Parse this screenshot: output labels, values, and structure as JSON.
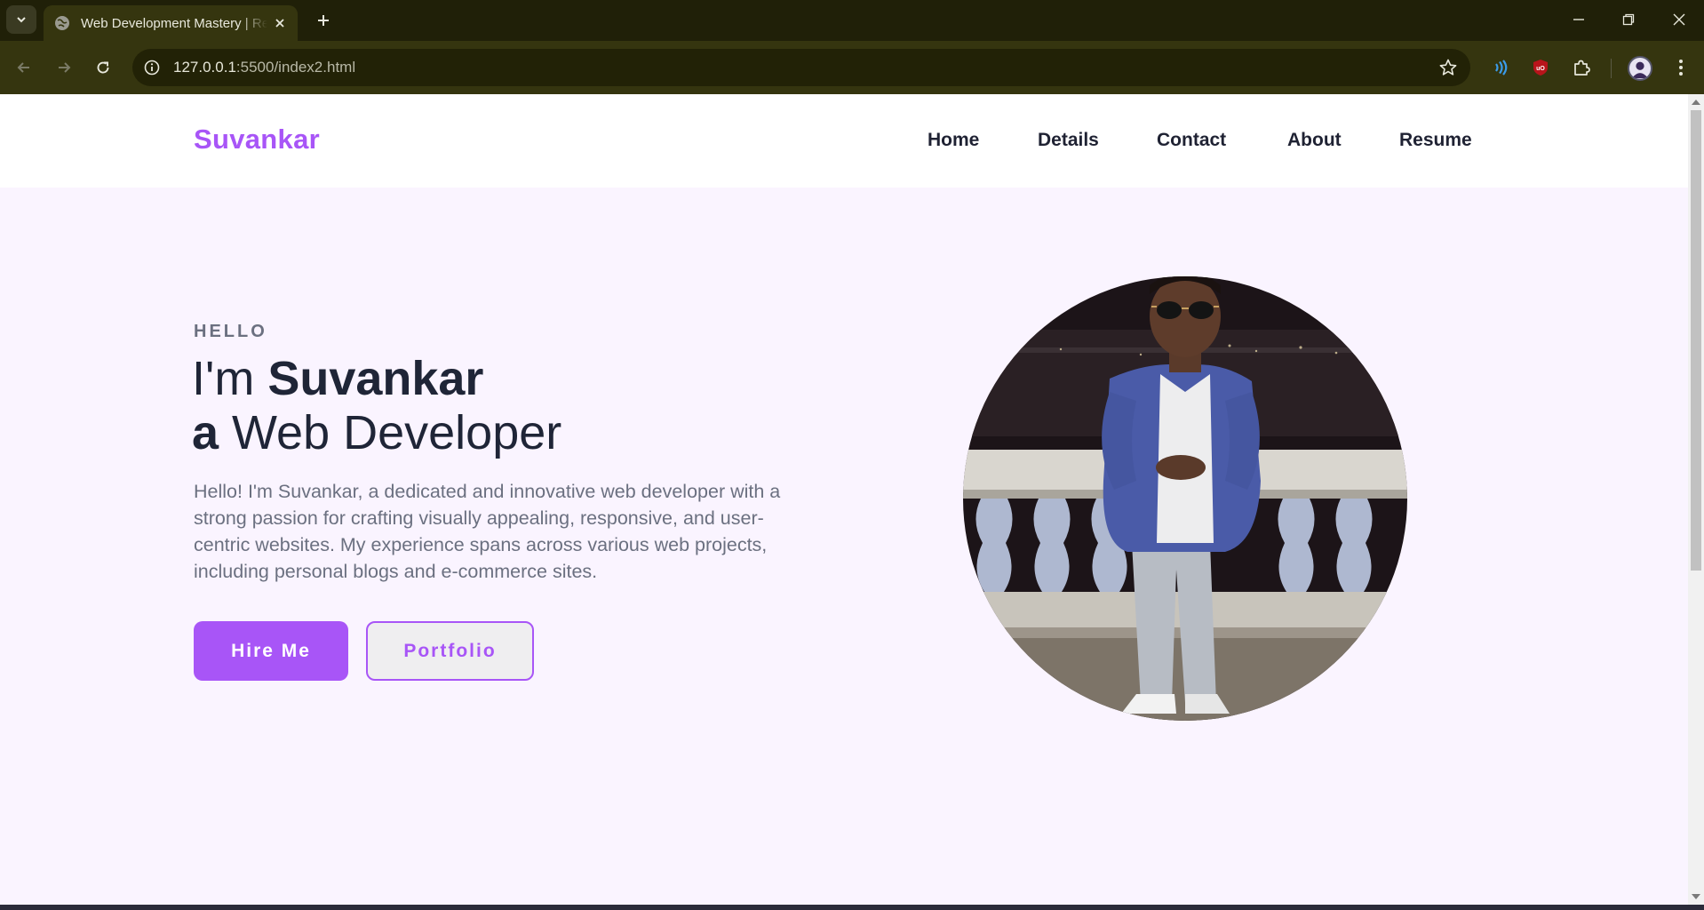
{
  "browser": {
    "tab_title": "Web Development Mastery | Re",
    "url_host": "127.0.0.1",
    "url_rest": ":5500/index2.html"
  },
  "site": {
    "logo": "Suvankar",
    "nav": [
      "Home",
      "Details",
      "Contact",
      "About",
      "Resume"
    ],
    "accent_color": "#a855f7"
  },
  "hero": {
    "eyebrow": "HELLO",
    "line1_prefix": "I'm ",
    "line1_name": "Suvankar",
    "line2_bold": "a",
    "line2_rest": " Web Developer",
    "bio": "Hello! I'm Suvankar, a dedicated and innovative web developer with a strong passion for crafting visually appealing, responsive, and user-centric websites. My experience spans across various web projects, including personal blogs and e-commerce sites.",
    "primary_button": "Hire Me",
    "secondary_button": "Portfolio"
  }
}
